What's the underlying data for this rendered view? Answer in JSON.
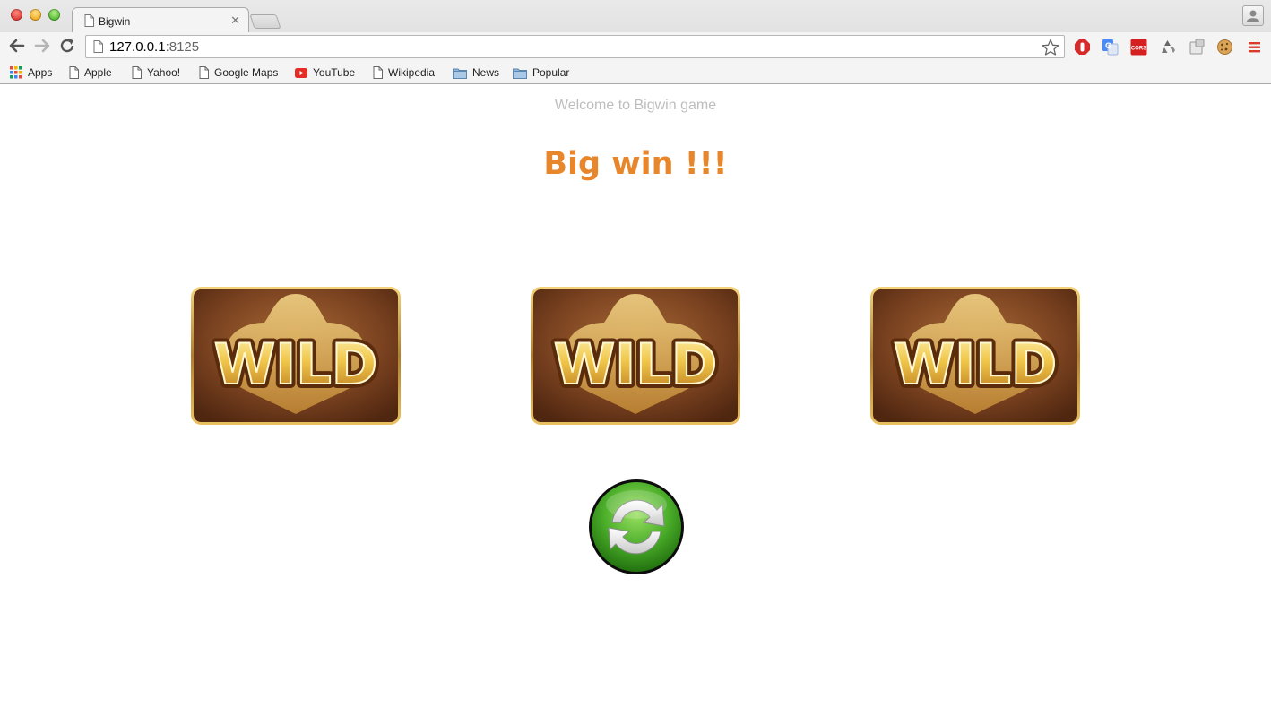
{
  "browser": {
    "tab": {
      "title": "Bigwin"
    },
    "address": {
      "host": "127.0.0.1",
      "port": ":8125"
    },
    "bookmarks": [
      {
        "label": "Apps",
        "icon": "apps-grid-icon"
      },
      {
        "label": "Apple",
        "icon": "page-icon"
      },
      {
        "label": "Yahoo!",
        "icon": "page-icon"
      },
      {
        "label": "Google Maps",
        "icon": "page-icon"
      },
      {
        "label": "YouTube",
        "icon": "youtube-icon"
      },
      {
        "label": "Wikipedia",
        "icon": "page-icon"
      },
      {
        "label": "News",
        "icon": "folder-icon"
      },
      {
        "label": "Popular",
        "icon": "folder-icon"
      }
    ],
    "extensions": [
      "adblock-icon",
      "translate-icon",
      "cors-icon",
      "recycle-icon",
      "extension-icon",
      "cookie-icon",
      "menu-icon"
    ],
    "extension_labels": {
      "cors": "CORS"
    }
  },
  "page": {
    "welcome": "Welcome to Bigwin game",
    "headline": "Big win !!!",
    "reels": [
      {
        "symbol": "WILD"
      },
      {
        "symbol": "WILD"
      },
      {
        "symbol": "WILD"
      }
    ],
    "spin_button": {
      "icon": "refresh-icon"
    }
  },
  "colors": {
    "headline": "#e8862c",
    "welcome": "#bdbdbd",
    "reel_frame": "#b0802e",
    "reel_bg": "#6b3a1c",
    "wild_gold": "#f0c64a",
    "spin_green": "#4caf2a"
  }
}
